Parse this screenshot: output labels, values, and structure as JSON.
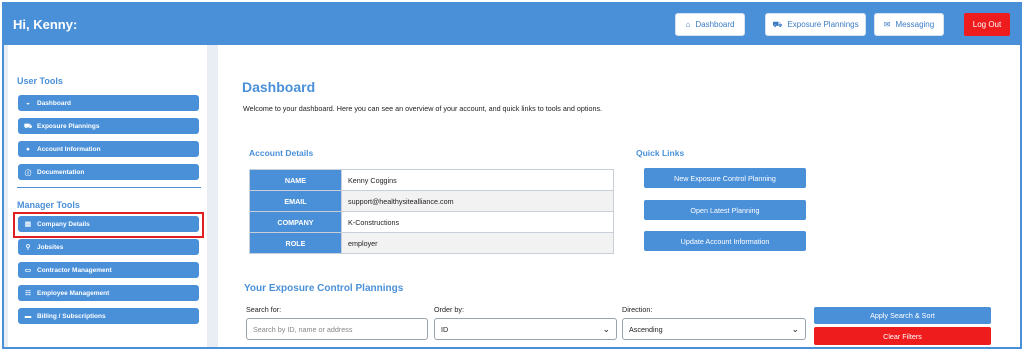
{
  "header": {
    "greeting": "Hi, Kenny:",
    "buttons": [
      {
        "label": "Dashboard",
        "icon": "home-icon",
        "glyph": "⌂"
      },
      {
        "label": "Exposure Plannings",
        "icon": "car-icon",
        "glyph": "⛟"
      },
      {
        "label": "Messaging",
        "icon": "envelope-icon",
        "glyph": "✉"
      }
    ],
    "logout_label": "Log Out"
  },
  "sidebar": {
    "user_tools_heading": "User Tools",
    "user_tools": [
      {
        "label": "Dashboard",
        "glyph": "◒"
      },
      {
        "label": "Exposure Plannings",
        "glyph": "⛟"
      },
      {
        "label": "Account Information",
        "glyph": "●"
      },
      {
        "label": "Documentation",
        "glyph": "ⓘ"
      }
    ],
    "manager_tools_heading": "Manager Tools",
    "manager_tools": [
      {
        "label": "Company Details",
        "glyph": "▤"
      },
      {
        "label": "Jobsites",
        "glyph": "⚲"
      },
      {
        "label": "Contractor Management",
        "glyph": "▭"
      },
      {
        "label": "Employee Management",
        "glyph": "☷"
      },
      {
        "label": "Billing / Subscriptions",
        "glyph": "▬"
      }
    ]
  },
  "main": {
    "title": "Dashboard",
    "welcome": "Welcome to your dashboard. Here you can see an overview of your account, and quick links to tools and options.",
    "account_heading": "Account Details",
    "account_rows": [
      {
        "key": "NAME",
        "value": "Kenny Coggins"
      },
      {
        "key": "EMAIL",
        "value": "support@healthysitealliance.com"
      },
      {
        "key": "COMPANY",
        "value": "K-Constructions"
      },
      {
        "key": "ROLE",
        "value": "employer"
      }
    ],
    "quick_links_heading": "Quick Links",
    "quick_links": [
      "New Exposure Control Planning",
      "Open Latest Planning",
      "Update Account Information"
    ],
    "plannings_heading": "Your Exposure Control Plannings",
    "search_label": "Search for:",
    "search_placeholder": "Search by ID, name or address",
    "order_label": "Order by:",
    "order_value": "ID",
    "direction_label": "Direction:",
    "direction_value": "Ascending",
    "apply_label": "Apply Search & Sort",
    "clear_label": "Clear Filters"
  },
  "colors": {
    "accent": "#4a90d9",
    "danger": "#ee1c1c",
    "highlight": "#e02020"
  }
}
